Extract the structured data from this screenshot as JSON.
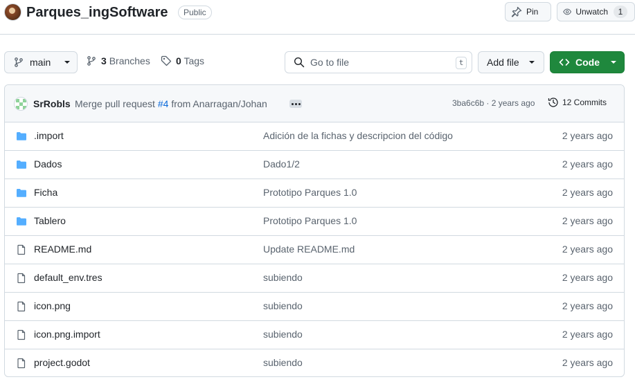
{
  "repo": {
    "name": "Parques_ingSoftware",
    "visibility": "Public",
    "pin_label": "Pin",
    "watch_label": "Unwatch",
    "watch_count": "1"
  },
  "toolbar": {
    "branch": "main",
    "branches_count": "3",
    "branches_label": "Branches",
    "tags_count": "0",
    "tags_label": "Tags",
    "search_placeholder": "Go to file",
    "search_shortcut": "t",
    "add_file_label": "Add file",
    "code_label": "Code"
  },
  "commit": {
    "author": "SrRobls",
    "message_prefix": "Merge pull request",
    "pr_link": "#4",
    "message_suffix": "from Anarragan/Johan",
    "hash_time": "3ba6c6b · 2 years ago",
    "commits_label": "12 Commits"
  },
  "files": [
    {
      "type": "folder",
      "name": ".import",
      "message": "Adición de la fichas y descripcion del código",
      "date": "2 years ago"
    },
    {
      "type": "folder",
      "name": "Dados",
      "message": "Dado1/2",
      "date": "2 years ago"
    },
    {
      "type": "folder",
      "name": "Ficha",
      "message": "Prototipo Parques 1.0",
      "date": "2 years ago"
    },
    {
      "type": "folder",
      "name": "Tablero",
      "message": "Prototipo Parques 1.0",
      "date": "2 years ago"
    },
    {
      "type": "file",
      "name": "README.md",
      "message": "Update README.md",
      "date": "2 years ago"
    },
    {
      "type": "file",
      "name": "default_env.tres",
      "message": "subiendo",
      "date": "2 years ago"
    },
    {
      "type": "file",
      "name": "icon.png",
      "message": "subiendo",
      "date": "2 years ago"
    },
    {
      "type": "file",
      "name": "icon.png.import",
      "message": "subiendo",
      "date": "2 years ago"
    },
    {
      "type": "file",
      "name": "project.godot",
      "message": "subiendo",
      "date": "2 years ago"
    }
  ],
  "colors": {
    "accent": "#0969da",
    "code_button": "#1f883d",
    "folder": "#54aeff"
  }
}
